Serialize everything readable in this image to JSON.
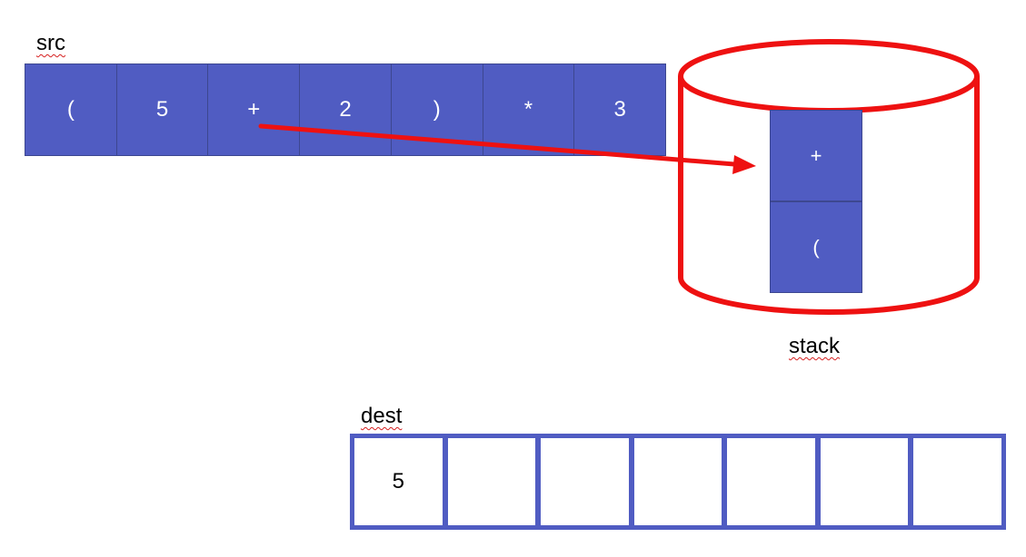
{
  "labels": {
    "src": "src",
    "stack": "stack",
    "dest": "dest"
  },
  "src": {
    "cells": [
      "(",
      "5",
      "+",
      "2",
      ")",
      "*",
      "3"
    ]
  },
  "stack": {
    "cells": [
      "+",
      "("
    ]
  },
  "dest": {
    "cells": [
      "5",
      "",
      "",
      "",
      "",
      "",
      ""
    ]
  },
  "colors": {
    "cell_fill": "#505cc2",
    "cylinder_outline": "#ee1111",
    "arrow": "#ee1111"
  }
}
